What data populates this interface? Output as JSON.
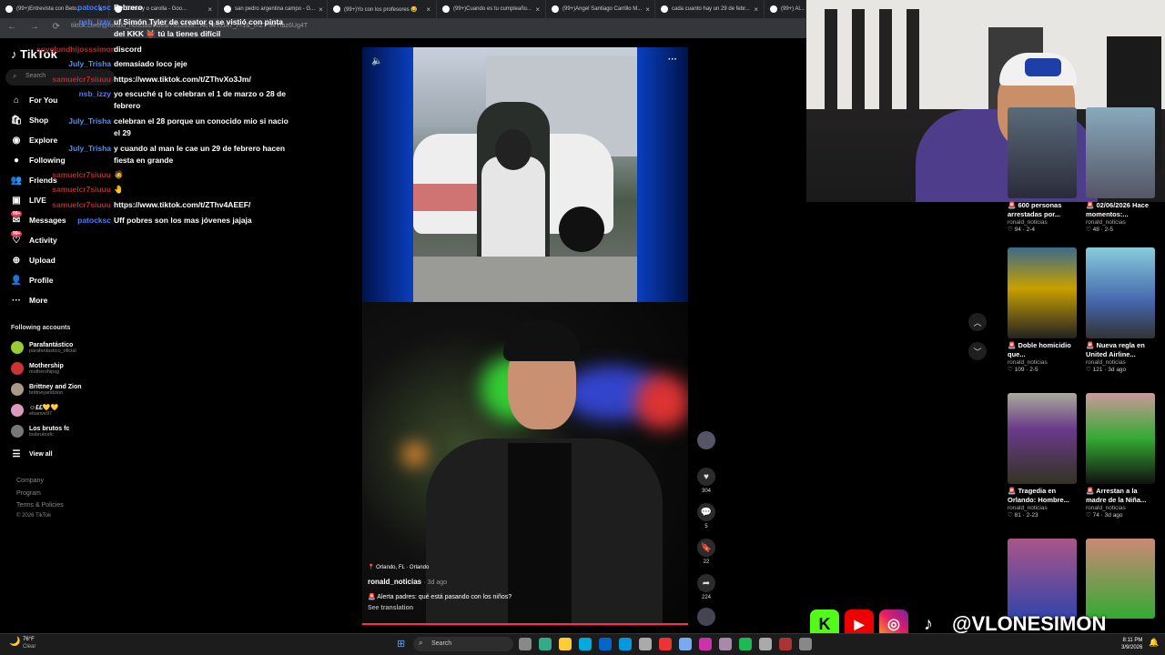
{
  "browser": {
    "tabs": [
      {
        "label": "(99+)Entrevista con Beto..."
      },
      {
        "label": "Camary o carolla - Goo..."
      },
      {
        "label": "san pedro argentina campo - G..."
      },
      {
        "label": "(99+)Yo con los profesores 😂"
      },
      {
        "label": "(99+)Cuando es tu cumpleaño..."
      },
      {
        "label": "(99+)Angel Santiago Carrillo M..."
      },
      {
        "label": "cada cuanto hay un 29 de febr..."
      },
      {
        "label": "(99+) Al..."
      }
    ],
    "url": "tiktok.com/@ronald_noticias/video/7613939...f4c7856147_r=1&_t=ZT-94Yfaz6Ug4T"
  },
  "chat": [
    {
      "user": "patocksc",
      "msg": "Febrero",
      "color": "#4a7dff"
    },
    {
      "user": "nsb_izzy",
      "msg": "uf Simón Tyler de creator q se vistió con pinta del KKK 👹 tú la tienes difícil",
      "color": "#4a7dff"
    },
    {
      "user": "soyelundhijosssimon",
      "msg": "discord",
      "color": "#b32d2d"
    },
    {
      "user": "July_Trisha",
      "msg": "demasiado loco jeje",
      "color": "#5a8fe0"
    },
    {
      "user": "samuelcr7siuuu",
      "msg": "https://www.tiktok.com/t/ZThvXo3Jm/",
      "color": "#b32d2d"
    },
    {
      "user": "nsb_izzy",
      "msg": "yo escuché q lo celebran el 1 de marzo o 28 de febrero",
      "color": "#4a7dff"
    },
    {
      "user": "July_Trisha",
      "msg": "celebran el 28 porque un conocido mio si nacio el 29",
      "color": "#5a8fe0"
    },
    {
      "user": "July_Trisha",
      "msg": "y cuando al man le cae un 29 de febrero hacen fiesta en grande",
      "color": "#5a8fe0"
    },
    {
      "user": "samuelcr7siuuu",
      "msg": "🧔",
      "color": "#b32d2d"
    },
    {
      "user": "samuelcr7siuuu",
      "msg": "🤚",
      "color": "#b32d2d"
    },
    {
      "user": "samuelcr7siuuu",
      "msg": "https://www.tiktok.com/t/ZThv4AEEF/",
      "color": "#b32d2d"
    },
    {
      "user": "patocksc",
      "msg": "Uff pobres son los mas jóvenes jajaja",
      "color": "#4a7dff"
    }
  ],
  "tiktok": {
    "logo": "TikTok",
    "search_placeholder": "Search",
    "nav": [
      {
        "label": "For You",
        "icon": "home-icon"
      },
      {
        "label": "Shop",
        "icon": "shop-icon"
      },
      {
        "label": "Explore",
        "icon": "compass-icon"
      },
      {
        "label": "Following",
        "icon": "following-icon"
      },
      {
        "label": "Friends",
        "icon": "friends-icon"
      },
      {
        "label": "LIVE",
        "icon": "live-icon"
      },
      {
        "label": "Messages",
        "icon": "messages-icon",
        "badge": "99+"
      },
      {
        "label": "Activity",
        "icon": "activity-icon",
        "badge": "99+"
      },
      {
        "label": "Upload",
        "icon": "upload-icon"
      },
      {
        "label": "Profile",
        "icon": "profile-icon"
      },
      {
        "label": "More",
        "icon": "more-icon"
      }
    ],
    "following_title": "Following accounts",
    "accounts": [
      {
        "name": "Parafantástico",
        "handle": "parafantastico_oficial"
      },
      {
        "name": "Mothership",
        "handle": "mothershipsg"
      },
      {
        "name": "Brittney and Zion",
        "handle": "brittneyandzion"
      },
      {
        "name": "☺︎££💛💛",
        "handle": "elsanve97"
      },
      {
        "name": "Los brutos fc",
        "handle": "losbrutosfc"
      }
    ],
    "view_all": "View all",
    "footer": [
      "Company",
      "Program",
      "Terms & Policies",
      "© 2026 TikTok"
    ]
  },
  "video": {
    "location": "Orlando, FL · Orlando",
    "author": "ronald_noticias",
    "time": "3d ago",
    "caption": "Alerta padres: qué está pasando con los niños?",
    "translate": "See translation",
    "likes": "304",
    "comments": "5",
    "saves": "22",
    "shares": "224"
  },
  "related": [
    {
      "title": "600 personas arrestadas por...",
      "author": "ronald_noticias",
      "likes": "94",
      "date": "2-4"
    },
    {
      "title": "02/06/2026 Hace momentos:...",
      "author": "ronald_noticias",
      "likes": "48",
      "date": "2-5"
    },
    {
      "title": "Doble homicidio que...",
      "author": "ronald_noticias",
      "likes": "109",
      "date": "2-5"
    },
    {
      "title": "Nueva regla en United Airline...",
      "author": "ronald_noticias",
      "likes": "121",
      "date": "3d ago"
    },
    {
      "title": "Tragedia en Orlando: Hombre...",
      "author": "ronald_noticias",
      "likes": "81",
      "date": "2-23"
    },
    {
      "title": "Arrestan a la madre de la Niña...",
      "author": "ronald_noticias",
      "likes": "74",
      "date": "3d ago"
    }
  ],
  "social": {
    "handle": "@VLONESIMON"
  },
  "taskbar": {
    "weather_temp": "76°F",
    "weather_desc": "Clear",
    "search": "Search",
    "time": "8:11 PM",
    "date": "3/9/2026"
  },
  "colors": {
    "tiktok_red": "#fe2c55",
    "chat_blue": "#4a7dff",
    "chat_red": "#b32d2d"
  }
}
